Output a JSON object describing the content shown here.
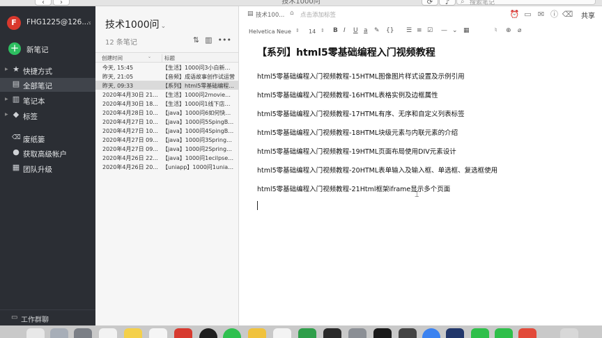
{
  "window": {
    "title": "技术1000问",
    "back": "‹",
    "forward": "›",
    "search_placeholder": "搜索笔记"
  },
  "sidebar": {
    "avatar_letter": "F",
    "account": "FHG1225@126....",
    "new_note": "新笔记",
    "items": [
      {
        "label": "快捷方式",
        "icon": "star-icon",
        "glyph": "★"
      },
      {
        "label": "全部笔记",
        "icon": "notes-icon",
        "glyph": "▤"
      },
      {
        "label": "笔记本",
        "icon": "notebook-icon",
        "glyph": "▥"
      },
      {
        "label": "标签",
        "icon": "tag-icon",
        "glyph": "◆"
      },
      {
        "label": "废纸篓",
        "icon": "trash-icon",
        "glyph": "🗑"
      },
      {
        "label": "获取高级帐户",
        "icon": "premium-icon",
        "glyph": "●"
      },
      {
        "label": "团队升级",
        "icon": "team-icon",
        "glyph": "▦"
      }
    ],
    "bottom": "工作群聊"
  },
  "notelist": {
    "title": "技术1000问",
    "count": "12 条笔记",
    "col_created": "创建时间",
    "col_title": "标题",
    "rows": [
      {
        "date": "今天, 15:45",
        "title": "【生活】1000问3小白新手..."
      },
      {
        "date": "昨天, 21:05",
        "title": "【音频】成语故事创作试运营"
      },
      {
        "date": "昨天, 09:33",
        "title": "【系列】html5零基础编程..."
      },
      {
        "date": "2020年4月30日 21...",
        "title": "【生活】1000问2movie如..."
      },
      {
        "date": "2020年4月30日 18...",
        "title": "【生活】1000问1线下店铺..."
      },
      {
        "date": "2020年4月28日 10...",
        "title": "【java】1000问6如何快速..."
      },
      {
        "date": "2020年4月27日 10...",
        "title": "【java】1000问5SpingBoo..."
      },
      {
        "date": "2020年4月27日 10...",
        "title": "【java】1000问4SpingBoo..."
      },
      {
        "date": "2020年4月27日 09...",
        "title": "【java】1000问3SpringBoo..."
      },
      {
        "date": "2020年4月27日 09...",
        "title": "【java】1000问2SpringBoo..."
      },
      {
        "date": "2020年4月26日 22...",
        "title": "【java】1000问1ecilpse如..."
      },
      {
        "date": "2020年4月26日 20...",
        "title": "【uniapp】1000问1uniapp..."
      }
    ],
    "selected_index": 2
  },
  "editor": {
    "notebook": "技术100...",
    "tag_placeholder": "点击添加标签",
    "share": "共享",
    "font": "Helvetica Neue",
    "font_size": "14",
    "title": "【系列】html5零基础编程入门视频教程",
    "paragraphs": [
      "html5零基础编程入门视频教程-15HTML图像图片样式设置及示例引用",
      "html5零基础编程入门视频教程-16HTML表格实例及边框属性",
      "html5零基础编程入门视频教程-17HTML有序、无序和自定义列表标签",
      "html5零基础编程入门视频教程-18HTML块级元素与内联元素的介绍",
      "html5零基础编程入门视频教程-19HTML页面布局使用DIV元素设计",
      "html5零基础编程入门视频教程-20HTML表单输入及输入框、单选框、复选框使用",
      "html5零基础编程入门视频教程-21Html框架iframe显示多个页面"
    ]
  },
  "colors": {
    "sidebar_bg": "#2b2e34",
    "accent_green": "#2dbe60",
    "avatar_red": "#d9382d"
  }
}
